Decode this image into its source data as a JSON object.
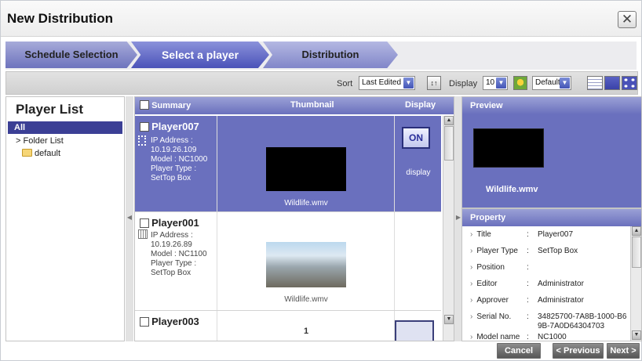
{
  "dialog": {
    "title": "New Distribution",
    "close_symbol": "✕"
  },
  "steps": [
    "Schedule Selection",
    "Select a player",
    "Distribution"
  ],
  "toolbar": {
    "sort_label": "Sort",
    "sort_value": "Last Edited",
    "sort_icon": "↕↑",
    "display_label": "Display",
    "display_count": "10",
    "display_mode": "Default"
  },
  "player_list": {
    "title": "Player List",
    "all": "All",
    "folder_list": "> Folder List",
    "folder": "default"
  },
  "grid": {
    "headers": {
      "summary": "Summary",
      "thumbnail": "Thumbnail",
      "display": "Display"
    },
    "rows": [
      {
        "name": "Player007",
        "info": [
          "IP Address :",
          "10.19.26.109",
          "Model : NC1000",
          "Player Type :",
          "SetTop Box"
        ],
        "file": "Wildlife.wmv",
        "display_button": "ON",
        "display_text": "display"
      },
      {
        "name": "Player001",
        "info": [
          "IP Address :",
          "10.19.26.89",
          "Model : NC1100",
          "Player Type :",
          "SetTop Box"
        ],
        "file": "Wildlife.wmv"
      },
      {
        "name": "Player003",
        "thumb_text": "1"
      }
    ]
  },
  "preview": {
    "title": "Preview",
    "file": "Wildlife.wmv"
  },
  "property": {
    "title": "Property",
    "rows": [
      {
        "key": "Title",
        "value": "Player007"
      },
      {
        "key": "Player Type",
        "value": "SetTop Box"
      },
      {
        "key": "Position",
        "value": ""
      },
      {
        "key": "Editor",
        "value": "Administrator"
      },
      {
        "key": "Approver",
        "value": "Administrator"
      },
      {
        "key": "Serial No.",
        "value": "34825700-7A8B-1000-B69B-7A0D64304703"
      },
      {
        "key": "Model name",
        "value": "NC1000"
      }
    ]
  },
  "footer": {
    "cancel": "Cancel",
    "previous": "< Previous",
    "next": "Next >"
  }
}
